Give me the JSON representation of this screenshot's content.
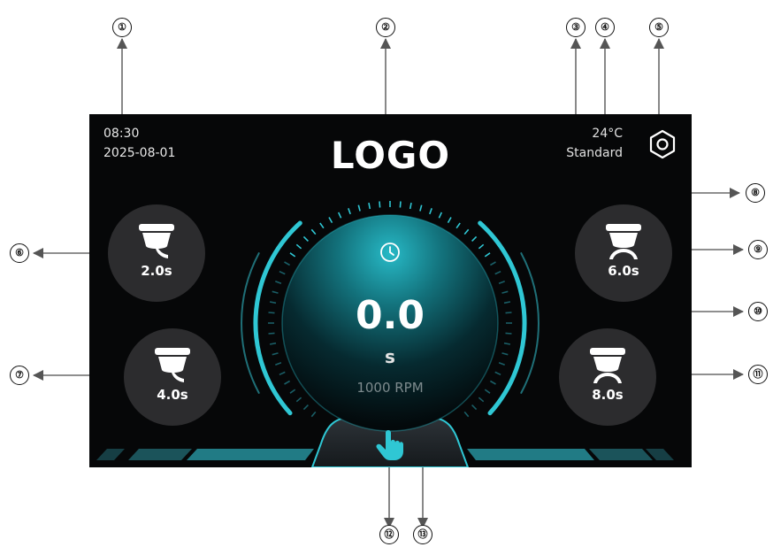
{
  "status": {
    "time": "08:30",
    "date": "2025-08-01",
    "temperature": "24°C",
    "mode": "Standard"
  },
  "header": {
    "logo": "LOGO"
  },
  "presets": [
    {
      "time": "2.0s",
      "icon": "single-cup-icon"
    },
    {
      "time": "4.0s",
      "icon": "single-cup-icon"
    },
    {
      "time": "6.0s",
      "icon": "double-cup-icon"
    },
    {
      "time": "8.0s",
      "icon": "double-cup-icon"
    }
  ],
  "timer": {
    "value": "0.0",
    "unit": "s",
    "rpm": "1000 RPM"
  },
  "icons": {
    "clock": "clock-icon",
    "settings": "settings-icon",
    "manual": "hand-pointer-icon"
  },
  "callouts": [
    "①",
    "②",
    "③",
    "④",
    "⑤",
    "⑥",
    "⑦",
    "⑧",
    "⑨",
    "⑩",
    "⑪",
    "⑫",
    "⑬"
  ],
  "colors": {
    "accent": "#2fc7d4",
    "background": "#060708",
    "button": "#2c2c2e"
  }
}
